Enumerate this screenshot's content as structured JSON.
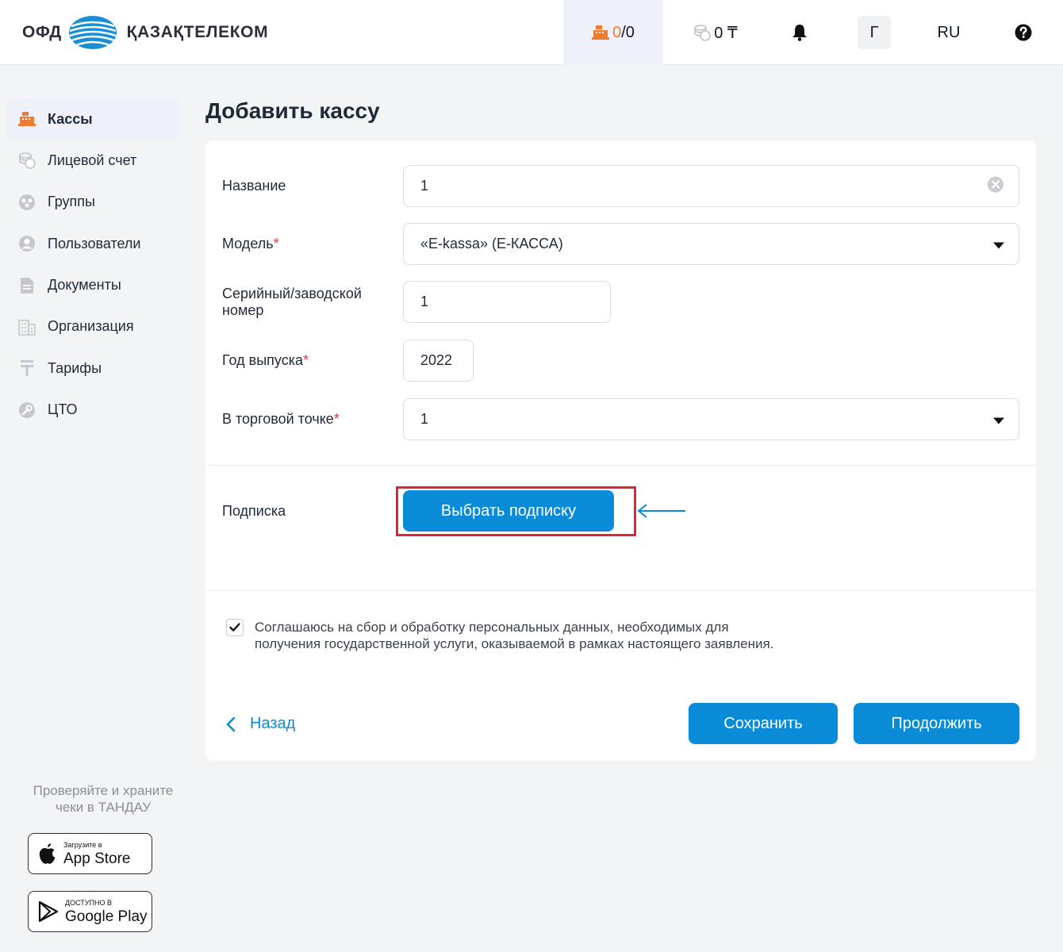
{
  "header": {
    "logo_left": "ОФД",
    "logo_right": "ҚАЗАҚТЕЛЕКОМ",
    "kassa_active": "0",
    "kassa_sep_total": "/0",
    "balance": "0 ₸",
    "user_initial": "Г",
    "language": "RU",
    "accent_color": "#ef7c30"
  },
  "sidebar": {
    "items": [
      {
        "label": "Кассы",
        "icon": "cash-register-icon",
        "active": true
      },
      {
        "label": "Лицевой счет",
        "icon": "coins-icon"
      },
      {
        "label": "Группы",
        "icon": "groups-icon"
      },
      {
        "label": "Пользователи",
        "icon": "user-icon"
      },
      {
        "label": "Документы",
        "icon": "document-icon"
      },
      {
        "label": "Организация",
        "icon": "building-icon"
      },
      {
        "label": "Тарифы",
        "icon": "tenge-icon"
      },
      {
        "label": "ЦТО",
        "icon": "wrench-icon"
      }
    ],
    "promo_line1": "Проверяйте и храните",
    "promo_line2": "чеки в ТАНДАУ",
    "appstore_small": "Загрузите в",
    "appstore_big": "App Store",
    "googleplay_small": "ДОСТУПНО В",
    "googleplay_big": "Google Play"
  },
  "main": {
    "title": "Добавить кассу",
    "form": {
      "name_label": "Название",
      "name_value": "1",
      "model_label": "Модель",
      "model_value": "«E-kassa» (Е-КАССА)",
      "serial_label_1": "Серийный/заводской",
      "serial_label_2": "номер",
      "serial_value": "1",
      "year_label": "Год выпуска",
      "year_value": "2022",
      "point_label": "В торговой точке",
      "point_value": "1",
      "required_mark": "*"
    },
    "subscription_label": "Подписка",
    "subscription_button": "Выбрать подписку",
    "consent_text": "Соглашаюсь на сбор и обработку персональных данных, необходимых для получения государственной услуги, оказываемой в рамках настоящего заявления.",
    "consent_checked": true,
    "back_label": "Назад",
    "save_label": "Сохранить",
    "continue_label": "Продолжить"
  },
  "colors": {
    "primary": "#0a8bd8",
    "highlight_frame": "#e02433",
    "required": "#e23b3b"
  }
}
